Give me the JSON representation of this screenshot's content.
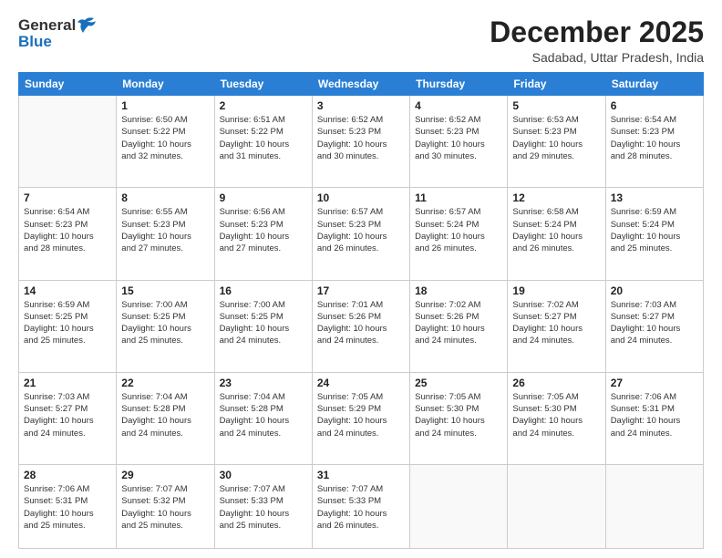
{
  "header": {
    "logo_general": "General",
    "logo_blue": "Blue",
    "month_title": "December 2025",
    "location": "Sadabad, Uttar Pradesh, India"
  },
  "days_of_week": [
    "Sunday",
    "Monday",
    "Tuesday",
    "Wednesday",
    "Thursday",
    "Friday",
    "Saturday"
  ],
  "weeks": [
    [
      {
        "day": "",
        "info": ""
      },
      {
        "day": "1",
        "info": "Sunrise: 6:50 AM\nSunset: 5:22 PM\nDaylight: 10 hours\nand 32 minutes."
      },
      {
        "day": "2",
        "info": "Sunrise: 6:51 AM\nSunset: 5:22 PM\nDaylight: 10 hours\nand 31 minutes."
      },
      {
        "day": "3",
        "info": "Sunrise: 6:52 AM\nSunset: 5:23 PM\nDaylight: 10 hours\nand 30 minutes."
      },
      {
        "day": "4",
        "info": "Sunrise: 6:52 AM\nSunset: 5:23 PM\nDaylight: 10 hours\nand 30 minutes."
      },
      {
        "day": "5",
        "info": "Sunrise: 6:53 AM\nSunset: 5:23 PM\nDaylight: 10 hours\nand 29 minutes."
      },
      {
        "day": "6",
        "info": "Sunrise: 6:54 AM\nSunset: 5:23 PM\nDaylight: 10 hours\nand 28 minutes."
      }
    ],
    [
      {
        "day": "7",
        "info": "Sunrise: 6:54 AM\nSunset: 5:23 PM\nDaylight: 10 hours\nand 28 minutes."
      },
      {
        "day": "8",
        "info": "Sunrise: 6:55 AM\nSunset: 5:23 PM\nDaylight: 10 hours\nand 27 minutes."
      },
      {
        "day": "9",
        "info": "Sunrise: 6:56 AM\nSunset: 5:23 PM\nDaylight: 10 hours\nand 27 minutes."
      },
      {
        "day": "10",
        "info": "Sunrise: 6:57 AM\nSunset: 5:23 PM\nDaylight: 10 hours\nand 26 minutes."
      },
      {
        "day": "11",
        "info": "Sunrise: 6:57 AM\nSunset: 5:24 PM\nDaylight: 10 hours\nand 26 minutes."
      },
      {
        "day": "12",
        "info": "Sunrise: 6:58 AM\nSunset: 5:24 PM\nDaylight: 10 hours\nand 26 minutes."
      },
      {
        "day": "13",
        "info": "Sunrise: 6:59 AM\nSunset: 5:24 PM\nDaylight: 10 hours\nand 25 minutes."
      }
    ],
    [
      {
        "day": "14",
        "info": "Sunrise: 6:59 AM\nSunset: 5:25 PM\nDaylight: 10 hours\nand 25 minutes."
      },
      {
        "day": "15",
        "info": "Sunrise: 7:00 AM\nSunset: 5:25 PM\nDaylight: 10 hours\nand 25 minutes."
      },
      {
        "day": "16",
        "info": "Sunrise: 7:00 AM\nSunset: 5:25 PM\nDaylight: 10 hours\nand 24 minutes."
      },
      {
        "day": "17",
        "info": "Sunrise: 7:01 AM\nSunset: 5:26 PM\nDaylight: 10 hours\nand 24 minutes."
      },
      {
        "day": "18",
        "info": "Sunrise: 7:02 AM\nSunset: 5:26 PM\nDaylight: 10 hours\nand 24 minutes."
      },
      {
        "day": "19",
        "info": "Sunrise: 7:02 AM\nSunset: 5:27 PM\nDaylight: 10 hours\nand 24 minutes."
      },
      {
        "day": "20",
        "info": "Sunrise: 7:03 AM\nSunset: 5:27 PM\nDaylight: 10 hours\nand 24 minutes."
      }
    ],
    [
      {
        "day": "21",
        "info": "Sunrise: 7:03 AM\nSunset: 5:27 PM\nDaylight: 10 hours\nand 24 minutes."
      },
      {
        "day": "22",
        "info": "Sunrise: 7:04 AM\nSunset: 5:28 PM\nDaylight: 10 hours\nand 24 minutes."
      },
      {
        "day": "23",
        "info": "Sunrise: 7:04 AM\nSunset: 5:28 PM\nDaylight: 10 hours\nand 24 minutes."
      },
      {
        "day": "24",
        "info": "Sunrise: 7:05 AM\nSunset: 5:29 PM\nDaylight: 10 hours\nand 24 minutes."
      },
      {
        "day": "25",
        "info": "Sunrise: 7:05 AM\nSunset: 5:30 PM\nDaylight: 10 hours\nand 24 minutes."
      },
      {
        "day": "26",
        "info": "Sunrise: 7:05 AM\nSunset: 5:30 PM\nDaylight: 10 hours\nand 24 minutes."
      },
      {
        "day": "27",
        "info": "Sunrise: 7:06 AM\nSunset: 5:31 PM\nDaylight: 10 hours\nand 24 minutes."
      }
    ],
    [
      {
        "day": "28",
        "info": "Sunrise: 7:06 AM\nSunset: 5:31 PM\nDaylight: 10 hours\nand 25 minutes."
      },
      {
        "day": "29",
        "info": "Sunrise: 7:07 AM\nSunset: 5:32 PM\nDaylight: 10 hours\nand 25 minutes."
      },
      {
        "day": "30",
        "info": "Sunrise: 7:07 AM\nSunset: 5:33 PM\nDaylight: 10 hours\nand 25 minutes."
      },
      {
        "day": "31",
        "info": "Sunrise: 7:07 AM\nSunset: 5:33 PM\nDaylight: 10 hours\nand 26 minutes."
      },
      {
        "day": "",
        "info": ""
      },
      {
        "day": "",
        "info": ""
      },
      {
        "day": "",
        "info": ""
      }
    ]
  ]
}
